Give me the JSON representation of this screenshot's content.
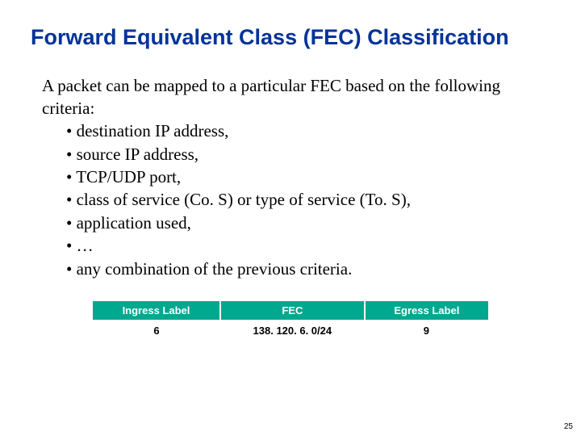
{
  "title": "Forward Equivalent Class (FEC) Classification",
  "intro": "A packet can be mapped to a particular FEC based on the following criteria:",
  "bullets": [
    "destination IP address,",
    "source IP address,",
    "TCP/UDP port,",
    "class of service (Co. S) or type of service (To. S),",
    "application used,",
    "…",
    "any combination of the previous criteria."
  ],
  "table": {
    "headers": [
      "Ingress Label",
      "FEC",
      "Egress Label"
    ],
    "row": [
      "6",
      "138. 120. 6. 0/24",
      "9"
    ]
  },
  "page": "25"
}
